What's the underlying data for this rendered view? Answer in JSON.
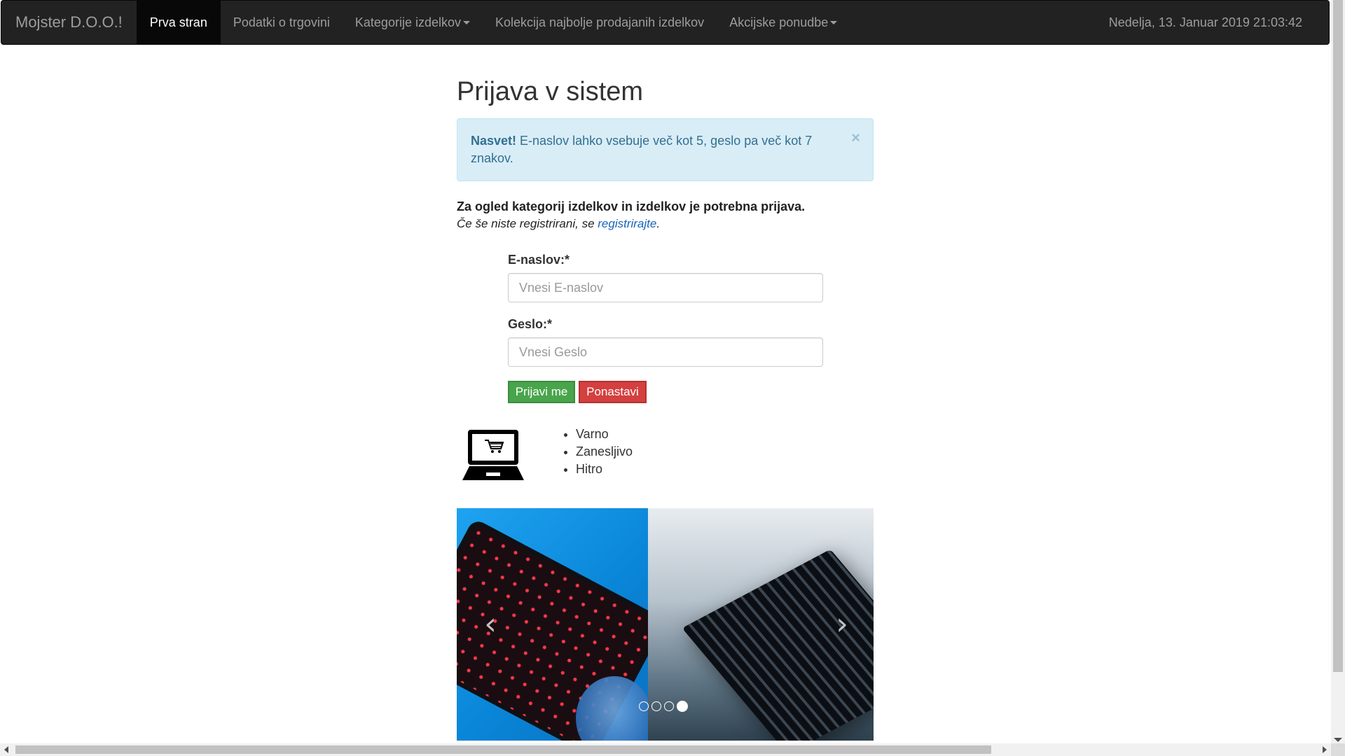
{
  "navbar": {
    "brand": "Mojster D.O.O.!",
    "items": [
      {
        "label": "Prva stran",
        "active": true
      },
      {
        "label": "Podatki o trgovini"
      },
      {
        "label": "Kategorije izdelkov",
        "dropdown": true
      },
      {
        "label": "Kolekcija najbolje prodajanih izdelkov"
      },
      {
        "label": "Akcijske ponudbe",
        "dropdown": true
      }
    ],
    "datetime": "Nedelja, 13. Januar 2019 21:03:42"
  },
  "page": {
    "title": "Prijava v sistem",
    "alert": {
      "strong": "Nasvet!",
      "text": " E-naslov lahko vsebuje več kot 5, geslo pa več kot 7 znakov.",
      "close": "×"
    },
    "intro_bold": "Za ogled kategorij izdelkov in izdelkov je potrebna prijava.",
    "intro_text": "Če še niste registrirani, se ",
    "intro_link": "registrirajte",
    "intro_end": "."
  },
  "form": {
    "email_label": "E-naslov:*",
    "email_placeholder": "Vnesi E-naslov",
    "email_value": "",
    "password_label": "Geslo:*",
    "password_placeholder": "Vnesi Geslo",
    "password_value": "",
    "login_button": "Prijavi me",
    "reset_button": "Ponastavi"
  },
  "features": [
    "Varno",
    "Zanesljivo",
    "Hitro"
  ],
  "icons": {
    "laptop": "laptop-cart-icon",
    "carousel_prev": "chevron-left-icon",
    "carousel_next": "chevron-right-icon"
  },
  "carousel": {
    "prev_glyph": "‹",
    "next_glyph": "›",
    "slide_count": 4,
    "active_slide": 4
  },
  "colors": {
    "navbar_bg": "#222222",
    "alert_bg": "#d9edf7",
    "alert_text": "#31708f",
    "link": "#1a64b8",
    "login_button": "#49a54b",
    "reset_button": "#d43f3f"
  }
}
